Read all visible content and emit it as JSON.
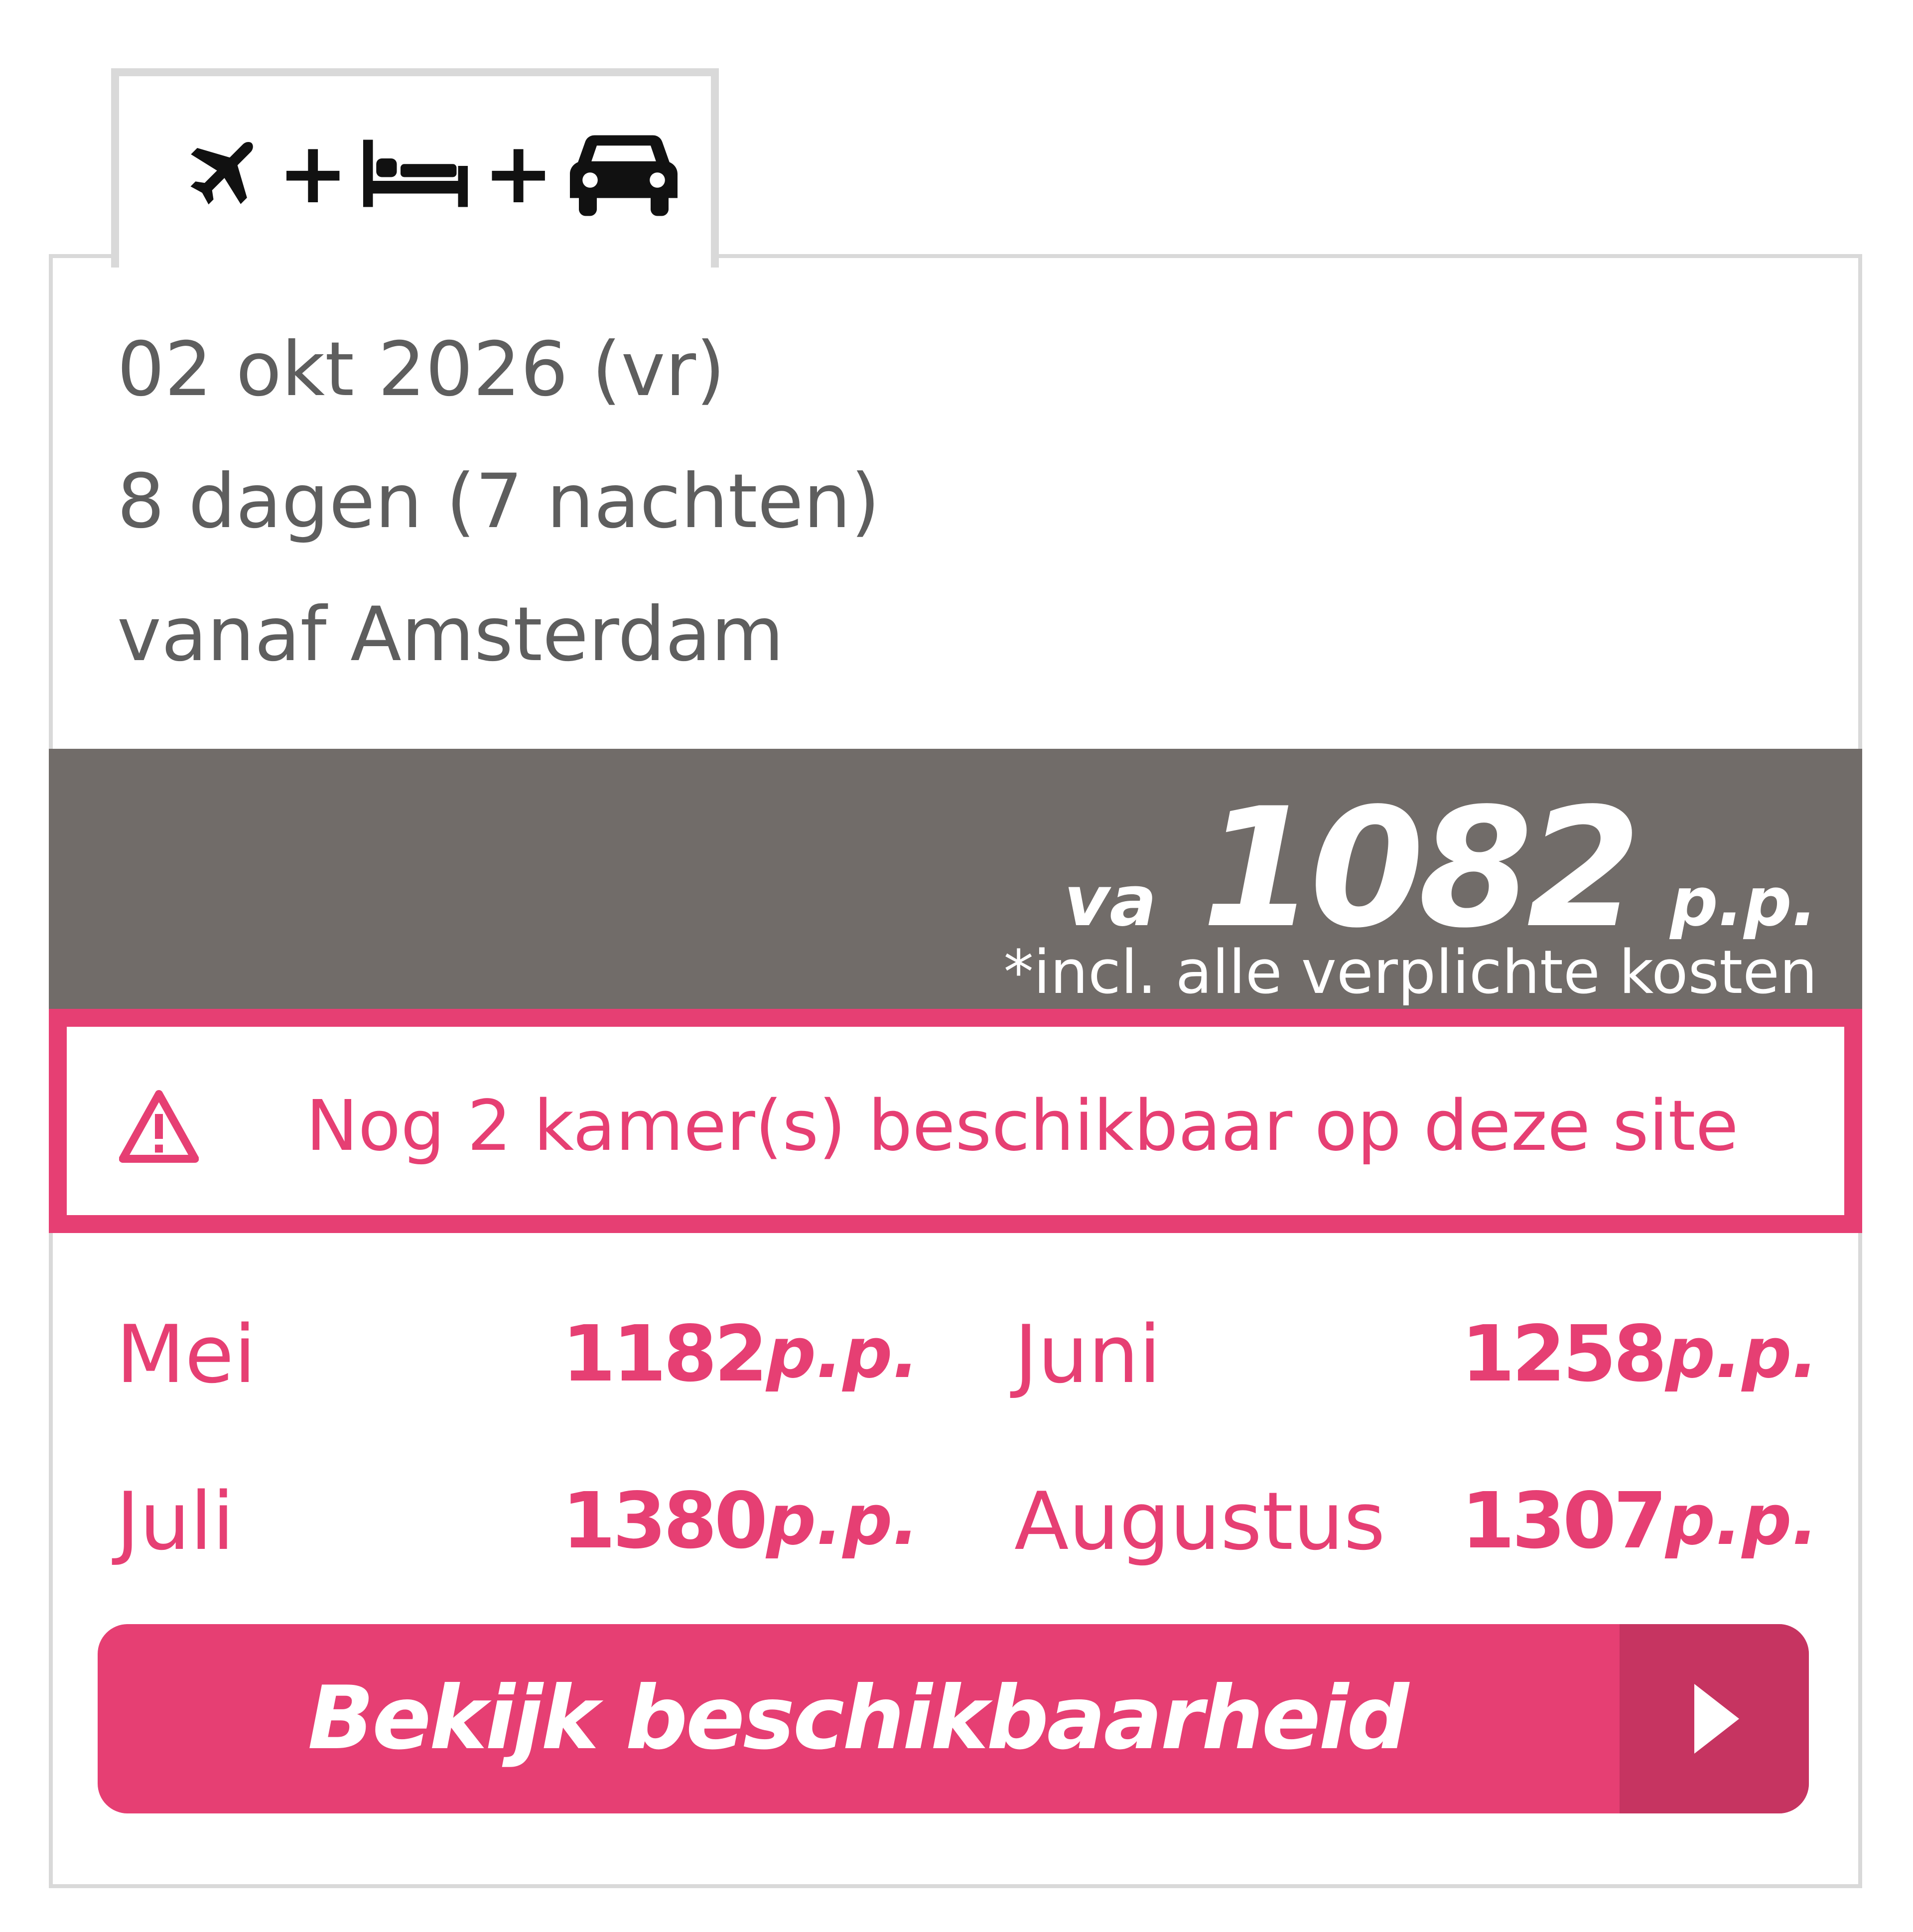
{
  "tab": {
    "icons": [
      "airplane-icon",
      "bed-icon",
      "car-icon"
    ],
    "separator": "+"
  },
  "trip": {
    "date": "02 okt 2026 (vr)",
    "duration": "8 dagen (7 nachten)",
    "departure": "vanaf Amsterdam"
  },
  "price": {
    "prefix": "va",
    "amount": "1082",
    "unit": "p.p.",
    "note": "*incl. alle verplichte kosten"
  },
  "alert": {
    "icon": "warning-icon",
    "text": "Nog 2 kamer(s) beschikbaar op deze site"
  },
  "months": [
    {
      "name": "Mei",
      "price": "1182",
      "unit": "p.p."
    },
    {
      "name": "Juni",
      "price": "1258",
      "unit": "p.p."
    },
    {
      "name": "Juli",
      "price": "1380",
      "unit": "p.p."
    },
    {
      "name": "Augustus",
      "price": "1307",
      "unit": "p.p."
    }
  ],
  "cta": {
    "label": "Bekijk beschikbaarheid",
    "icon": "chevron-right-icon"
  },
  "colors": {
    "accent": "#e63f73",
    "accent_dark": "#c63461",
    "price_band": "#716c69",
    "text_muted": "#5e5e5e",
    "border": "#d9d9d9"
  }
}
